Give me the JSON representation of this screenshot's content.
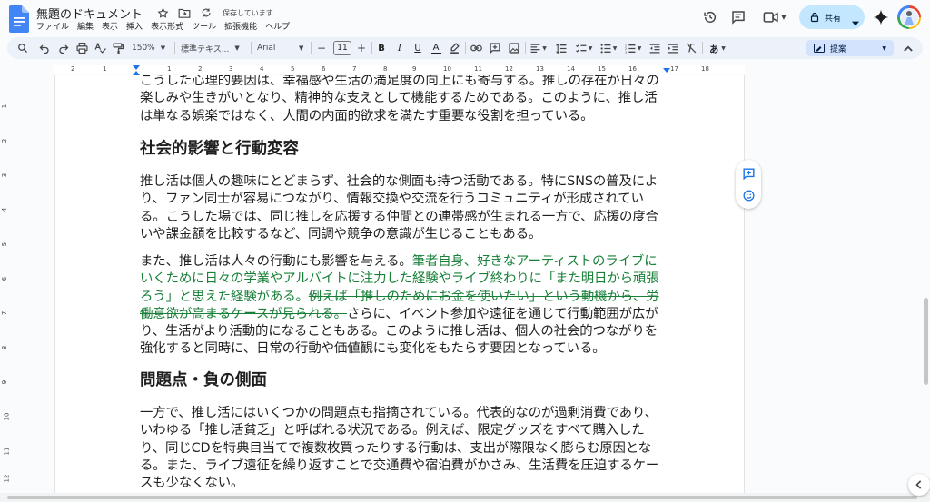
{
  "header": {
    "title": "無題のドキュメント",
    "save_status": "保存しています...",
    "menu": [
      "ファイル",
      "編集",
      "表示",
      "挿入",
      "表示形式",
      "ツール",
      "拡張機能",
      "ヘルプ"
    ],
    "share_label": "共有"
  },
  "toolbar": {
    "zoom": "150%",
    "style": "標準テキス...",
    "font": "Arial",
    "font_size": "11",
    "input_mode": "あ",
    "mode_label": "提案"
  },
  "ruler": {
    "labels": [
      "2",
      "1",
      "1",
      "2",
      "3",
      "4",
      "5",
      "6",
      "7",
      "8",
      "9",
      "10",
      "11",
      "12",
      "13",
      "14",
      "15",
      "16",
      "17",
      "18"
    ]
  },
  "vruler": {
    "labels": [
      "1",
      "2",
      "3",
      "4",
      "5",
      "6",
      "7",
      "8",
      "9",
      "10",
      "11",
      "12"
    ]
  },
  "document": {
    "p1": "こうした心理的要因は、幸福感や生活の満足度の向上にも寄与する。推しの存在が日々の楽しみや生きがいとなり、精神的な支えとして機能するためである。このように、推し活は単なる娯楽ではなく、人間の内面的欲求を満たす重要な役割を担っている。",
    "h_social": "社会的影響と行動変容",
    "p2": "推し活は個人の趣味にとどまらず、社会的な側面も持つ活動である。特にSNSの普及により、ファン同士が容易につながり、情報交換や交流を行うコミュニティが形成されている。こうした場では、同じ推しを応援する仲間との連帯感が生まれる一方で、応援の度合いや課金額を比較するなど、同調や競争の意識が生じることもある。",
    "p3_a": "また、推し活は人々の行動にも影響を与える。",
    "p3_ins": "筆者自身、好きなアーティストのライブにいくために日々の学業やアルバイトに注力した経験やライブ終わりに「また明日から頑張ろう」と思えた経験がある。",
    "p3_del": "例えば「推しのためにお金を使いたい」という動機から、労働意欲が高まるケースが見られる。",
    "p3_b": "さらに、イベント参加や遠征を通じて行動範囲が広がり、生活がより活動的になることもある。このように推し活は、個人の社会的つながりを強化すると同時に、日常の行動や価値観にも変化をもたらす要因となっている。",
    "h_problems": "問題点・負の側面",
    "p4": "一方で、推し活にはいくつかの問題点も指摘されている。代表的なのが過剰消費であり、いわゆる「推し活貧乏」と呼ばれる状況である。例えば、限定グッズをすべて購入したり、同じCDを特典目当てで複数枚買ったりする行動は、支出が際限なく膨らむ原因となる。また、ライブ遠征を繰り返すことで交通費や宿泊費がかさみ、生活費を圧迫するケースも少なくない。"
  },
  "colors": {
    "suggestion": "#188038",
    "share_bg": "#c2e7ff",
    "toolbar_bg": "#edf2fa",
    "accent": "#1a73e8"
  }
}
